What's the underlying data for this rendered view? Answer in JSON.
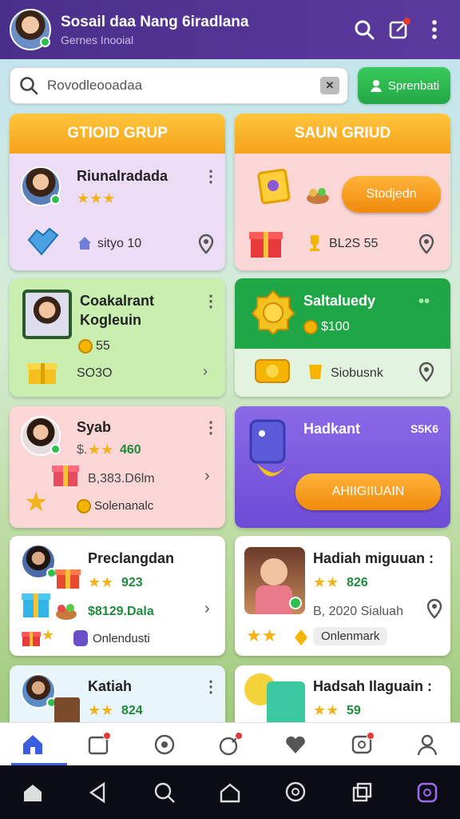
{
  "header": {
    "title": "Sosail daa Nang 6iradlana",
    "subtitle": "Gernes Inooial"
  },
  "search": {
    "value": "Rovodleooadaa",
    "button_label": "Sprenbati"
  },
  "groups": {
    "left_header": "GTIOID GRUP",
    "right_header": "SAUN GRIUD"
  },
  "cards": {
    "c1": {
      "name": "Riunalradada",
      "meta": "sityo 10"
    },
    "c2": {
      "pill": "Stodjedn",
      "meta": "BL2S 55"
    },
    "c3": {
      "name1": "Coakalrant",
      "name2": "Kogleuin",
      "coins": "55",
      "meta": "SO3O"
    },
    "c4": {
      "name": "Saltaluedy",
      "coins": "$100",
      "meta": "Siobusnk"
    },
    "c5": {
      "name": "Syab",
      "score": "460",
      "price": "B,383.D6lm",
      "tag": "Solenanalc",
      "stars_prefix": "$."
    },
    "c6": {
      "name": "Hadkant",
      "right": "S5K6",
      "pill": "AHIIGIIUAIN"
    },
    "c7": {
      "name": "Preclangdan",
      "score": "923",
      "price": "$8129.Dala",
      "tag": "Onlendusti"
    },
    "c8": {
      "name": "Hadiah miguuan :",
      "score": "826",
      "price": "B, 2020 Sialuah",
      "tag": "Onlenmark"
    },
    "c9": {
      "name": "Katiah",
      "score": "824"
    },
    "c10": {
      "name": "Hadsah Ilaguain :",
      "score": "59"
    }
  },
  "colors": {
    "topbar": "#4a2f8a",
    "accent_green": "#22a845",
    "accent_orange": "#f6a21c",
    "purple_card": "#7b5be0"
  }
}
